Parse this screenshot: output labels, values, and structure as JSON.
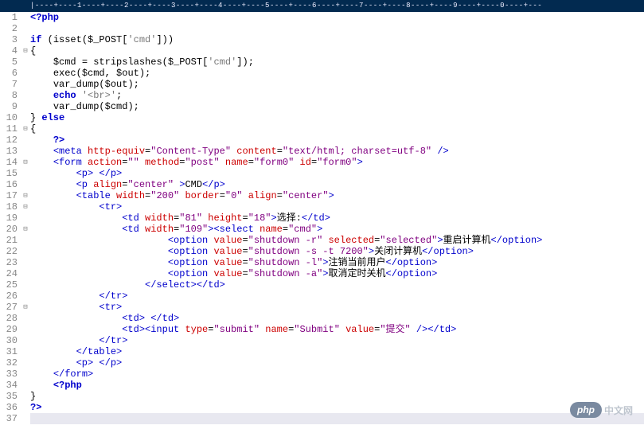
{
  "ruler": "|----+----1----+----2----+----3----+----4----+----5----+----6----+----7----+----8----+----9----+----0----+---",
  "lines": [
    {
      "n": 1,
      "fold": "",
      "seg": [
        [
          "kw",
          "<?php"
        ]
      ]
    },
    {
      "n": 2,
      "fold": "",
      "seg": []
    },
    {
      "n": 3,
      "fold": "",
      "seg": [
        [
          "kw",
          "if "
        ],
        [
          "punc",
          "("
        ],
        [
          "fn",
          "isset"
        ],
        [
          "punc",
          "("
        ],
        [
          "var",
          "$_POST"
        ],
        [
          "punc",
          "["
        ],
        [
          "str",
          "'cmd'"
        ],
        [
          "punc",
          "]))"
        ]
      ]
    },
    {
      "n": 4,
      "fold": "⊟",
      "seg": [
        [
          "punc",
          "{"
        ]
      ]
    },
    {
      "n": 5,
      "fold": "",
      "seg": [
        [
          "plain",
          "    "
        ],
        [
          "var",
          "$cmd"
        ],
        [
          "punc",
          " = "
        ],
        [
          "fn",
          "stripslashes"
        ],
        [
          "punc",
          "("
        ],
        [
          "var",
          "$_POST"
        ],
        [
          "punc",
          "["
        ],
        [
          "str",
          "'cmd'"
        ],
        [
          "punc",
          "]);"
        ]
      ]
    },
    {
      "n": 6,
      "fold": "",
      "seg": [
        [
          "plain",
          "    "
        ],
        [
          "fn",
          "exec"
        ],
        [
          "punc",
          "("
        ],
        [
          "var",
          "$cmd"
        ],
        [
          "punc",
          ", "
        ],
        [
          "var",
          "$out"
        ],
        [
          "punc",
          ");"
        ]
      ]
    },
    {
      "n": 7,
      "fold": "",
      "seg": [
        [
          "plain",
          "    "
        ],
        [
          "fn",
          "var_dump"
        ],
        [
          "punc",
          "("
        ],
        [
          "var",
          "$out"
        ],
        [
          "punc",
          ");"
        ]
      ]
    },
    {
      "n": 8,
      "fold": "",
      "seg": [
        [
          "plain",
          "    "
        ],
        [
          "kw",
          "echo "
        ],
        [
          "str",
          "'<br>'"
        ],
        [
          "punc",
          ";"
        ]
      ]
    },
    {
      "n": 9,
      "fold": "",
      "seg": [
        [
          "plain",
          "    "
        ],
        [
          "fn",
          "var_dump"
        ],
        [
          "punc",
          "("
        ],
        [
          "var",
          "$cmd"
        ],
        [
          "punc",
          ");"
        ]
      ]
    },
    {
      "n": 10,
      "fold": "",
      "seg": [
        [
          "punc",
          "} "
        ],
        [
          "kw",
          "else"
        ]
      ]
    },
    {
      "n": 11,
      "fold": "⊟",
      "seg": [
        [
          "punc",
          "{"
        ]
      ]
    },
    {
      "n": 12,
      "fold": "",
      "seg": [
        [
          "plain",
          "    "
        ],
        [
          "kw",
          "?>"
        ]
      ]
    },
    {
      "n": 13,
      "fold": "",
      "seg": [
        [
          "plain",
          "    "
        ],
        [
          "tag",
          "<meta "
        ],
        [
          "attr",
          "http-equiv"
        ],
        [
          "punc",
          "="
        ],
        [
          "val",
          "\"Content-Type\""
        ],
        [
          "attr",
          " content"
        ],
        [
          "punc",
          "="
        ],
        [
          "val",
          "\"text/html; charset=utf-8\""
        ],
        [
          "tag",
          " />"
        ]
      ]
    },
    {
      "n": 14,
      "fold": "⊟",
      "seg": [
        [
          "plain",
          "    "
        ],
        [
          "tag",
          "<form "
        ],
        [
          "attr",
          "action"
        ],
        [
          "punc",
          "="
        ],
        [
          "val",
          "\"\""
        ],
        [
          "attr",
          " method"
        ],
        [
          "punc",
          "="
        ],
        [
          "val",
          "\"post\""
        ],
        [
          "attr",
          " name"
        ],
        [
          "punc",
          "="
        ],
        [
          "val",
          "\"form0\""
        ],
        [
          "attr",
          " id"
        ],
        [
          "punc",
          "="
        ],
        [
          "val",
          "\"form0\""
        ],
        [
          "tag",
          ">"
        ]
      ]
    },
    {
      "n": 15,
      "fold": "",
      "seg": [
        [
          "plain",
          "        "
        ],
        [
          "tag",
          "<p> </p>"
        ]
      ]
    },
    {
      "n": 16,
      "fold": "",
      "seg": [
        [
          "plain",
          "        "
        ],
        [
          "tag",
          "<p "
        ],
        [
          "attr",
          "align"
        ],
        [
          "punc",
          "="
        ],
        [
          "val",
          "\"center\""
        ],
        [
          "tag",
          " >"
        ],
        [
          "plain",
          "CMD"
        ],
        [
          "tag",
          "</p>"
        ]
      ]
    },
    {
      "n": 17,
      "fold": "⊟",
      "seg": [
        [
          "plain",
          "        "
        ],
        [
          "tag",
          "<table "
        ],
        [
          "attr",
          "width"
        ],
        [
          "punc",
          "="
        ],
        [
          "val",
          "\"200\""
        ],
        [
          "attr",
          " border"
        ],
        [
          "punc",
          "="
        ],
        [
          "val",
          "\"0\""
        ],
        [
          "attr",
          " align"
        ],
        [
          "punc",
          "="
        ],
        [
          "val",
          "\"center\""
        ],
        [
          "tag",
          ">"
        ]
      ]
    },
    {
      "n": 18,
      "fold": "⊟",
      "seg": [
        [
          "plain",
          "            "
        ],
        [
          "tag",
          "<tr>"
        ]
      ]
    },
    {
      "n": 19,
      "fold": "",
      "seg": [
        [
          "plain",
          "                "
        ],
        [
          "tag",
          "<td "
        ],
        [
          "attr",
          "width"
        ],
        [
          "punc",
          "="
        ],
        [
          "val",
          "\"81\""
        ],
        [
          "attr",
          " height"
        ],
        [
          "punc",
          "="
        ],
        [
          "val",
          "\"18\""
        ],
        [
          "tag",
          ">"
        ],
        [
          "cjk",
          "选择:"
        ],
        [
          "tag",
          "</td>"
        ]
      ]
    },
    {
      "n": 20,
      "fold": "⊟",
      "seg": [
        [
          "plain",
          "                "
        ],
        [
          "tag",
          "<td "
        ],
        [
          "attr",
          "width"
        ],
        [
          "punc",
          "="
        ],
        [
          "val",
          "\"109\""
        ],
        [
          "tag",
          "><select "
        ],
        [
          "attr",
          "name"
        ],
        [
          "punc",
          "="
        ],
        [
          "val",
          "\"cmd\""
        ],
        [
          "tag",
          ">"
        ]
      ]
    },
    {
      "n": 21,
      "fold": "",
      "seg": [
        [
          "plain",
          "                        "
        ],
        [
          "tag",
          "<option "
        ],
        [
          "attr",
          "value"
        ],
        [
          "punc",
          "="
        ],
        [
          "val",
          "\"shutdown -r\""
        ],
        [
          "attr",
          " selected"
        ],
        [
          "punc",
          "="
        ],
        [
          "val",
          "\"selected\""
        ],
        [
          "tag",
          ">"
        ],
        [
          "cjk",
          "重启计算机"
        ],
        [
          "tag",
          "</option>"
        ]
      ]
    },
    {
      "n": 22,
      "fold": "",
      "seg": [
        [
          "plain",
          "                        "
        ],
        [
          "tag",
          "<option "
        ],
        [
          "attr",
          "value"
        ],
        [
          "punc",
          "="
        ],
        [
          "val",
          "\"shutdown -s -t 7200\""
        ],
        [
          "tag",
          ">"
        ],
        [
          "cjk",
          "关闭计算机"
        ],
        [
          "tag",
          "</option>"
        ]
      ]
    },
    {
      "n": 23,
      "fold": "",
      "seg": [
        [
          "plain",
          "                        "
        ],
        [
          "tag",
          "<option "
        ],
        [
          "attr",
          "value"
        ],
        [
          "punc",
          "="
        ],
        [
          "val",
          "\"shutdown -l\""
        ],
        [
          "tag",
          ">"
        ],
        [
          "cjk",
          "注销当前用户"
        ],
        [
          "tag",
          "</option>"
        ]
      ]
    },
    {
      "n": 24,
      "fold": "",
      "seg": [
        [
          "plain",
          "                        "
        ],
        [
          "tag",
          "<option "
        ],
        [
          "attr",
          "value"
        ],
        [
          "punc",
          "="
        ],
        [
          "val",
          "\"shutdown -a\""
        ],
        [
          "tag",
          ">"
        ],
        [
          "cjk",
          "取消定时关机"
        ],
        [
          "tag",
          "</option>"
        ]
      ]
    },
    {
      "n": 25,
      "fold": "",
      "seg": [
        [
          "plain",
          "                    "
        ],
        [
          "tag",
          "</select></td>"
        ]
      ]
    },
    {
      "n": 26,
      "fold": "",
      "seg": [
        [
          "plain",
          "            "
        ],
        [
          "tag",
          "</tr>"
        ]
      ]
    },
    {
      "n": 27,
      "fold": "⊟",
      "seg": [
        [
          "plain",
          "            "
        ],
        [
          "tag",
          "<tr>"
        ]
      ]
    },
    {
      "n": 28,
      "fold": "",
      "seg": [
        [
          "plain",
          "                "
        ],
        [
          "tag",
          "<td> </td>"
        ]
      ]
    },
    {
      "n": 29,
      "fold": "",
      "seg": [
        [
          "plain",
          "                "
        ],
        [
          "tag",
          "<td><input "
        ],
        [
          "attr",
          "type"
        ],
        [
          "punc",
          "="
        ],
        [
          "val",
          "\"submit\""
        ],
        [
          "attr",
          " name"
        ],
        [
          "punc",
          "="
        ],
        [
          "val",
          "\"Submit\""
        ],
        [
          "attr",
          " value"
        ],
        [
          "punc",
          "="
        ],
        [
          "val",
          "\"提交\""
        ],
        [
          "tag",
          " /></td>"
        ]
      ]
    },
    {
      "n": 30,
      "fold": "",
      "seg": [
        [
          "plain",
          "            "
        ],
        [
          "tag",
          "</tr>"
        ]
      ]
    },
    {
      "n": 31,
      "fold": "",
      "seg": [
        [
          "plain",
          "        "
        ],
        [
          "tag",
          "</table>"
        ]
      ]
    },
    {
      "n": 32,
      "fold": "",
      "seg": [
        [
          "plain",
          "        "
        ],
        [
          "tag",
          "<p> </p>"
        ]
      ]
    },
    {
      "n": 33,
      "fold": "",
      "seg": [
        [
          "plain",
          "    "
        ],
        [
          "tag",
          "</form>"
        ]
      ]
    },
    {
      "n": 34,
      "fold": "",
      "seg": [
        [
          "plain",
          "    "
        ],
        [
          "kw",
          "<?php"
        ]
      ]
    },
    {
      "n": 35,
      "fold": "",
      "seg": [
        [
          "punc",
          "}"
        ]
      ]
    },
    {
      "n": 36,
      "fold": "",
      "seg": [
        [
          "kw",
          "?>"
        ]
      ]
    },
    {
      "n": 37,
      "fold": "",
      "seg": [],
      "current": true
    }
  ],
  "logo": {
    "pill": "php",
    "text": "中文网"
  }
}
